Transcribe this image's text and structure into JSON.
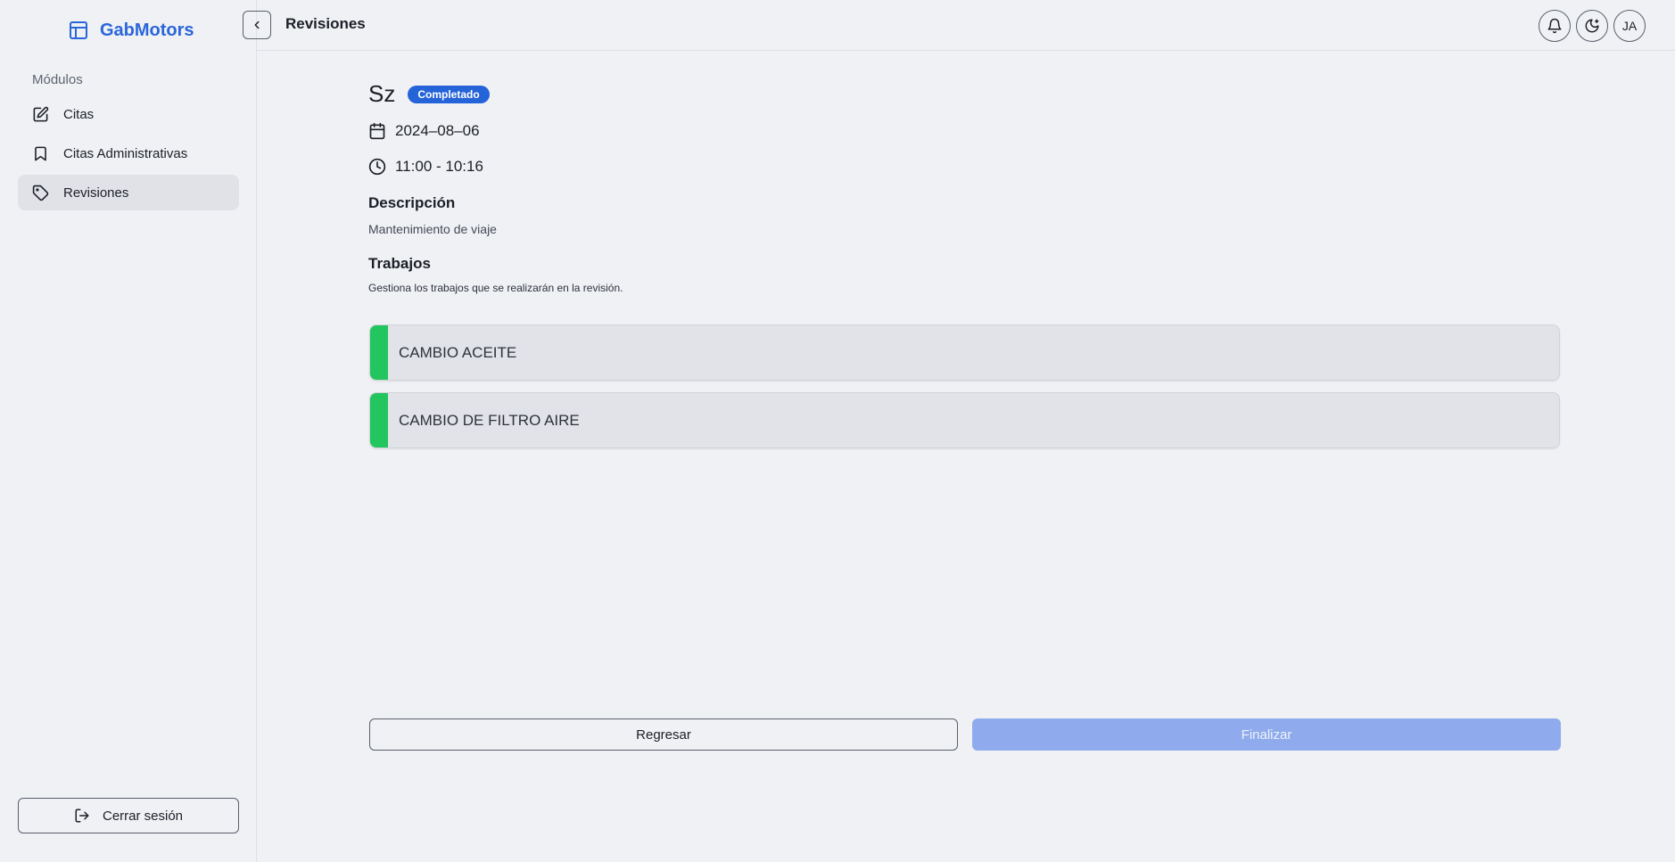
{
  "brand": {
    "name": "GabMotors"
  },
  "sidebar": {
    "section_label": "Módulos",
    "items": [
      {
        "label": "Citas",
        "icon": "edit-icon"
      },
      {
        "label": "Citas Administrativas",
        "icon": "bookmark-icon"
      },
      {
        "label": "Revisiones",
        "icon": "tag-icon",
        "active": true
      }
    ],
    "logout_label": "Cerrar sesión"
  },
  "header": {
    "title": "Revisiones",
    "avatar_initials": "JA"
  },
  "revision": {
    "vehicle": "Sz",
    "status": "Completado",
    "date": "2024–08–06",
    "time": "11:00 - 10:16",
    "description_heading": "Descripción",
    "description": "Mantenimiento de viaje",
    "jobs_heading": "Trabajos",
    "jobs_subtitle": "Gestiona los trabajos que se realizarán en la revisión.",
    "jobs": [
      {
        "label": "CAMBIO ACEITE",
        "status_color": "#22c55e"
      },
      {
        "label": "CAMBIO DE FILTRO AIRE",
        "status_color": "#22c55e"
      }
    ]
  },
  "actions": {
    "back_label": "Regresar",
    "finish_label": "Finalizar"
  },
  "colors": {
    "accent": "#2563d8",
    "finish_disabled": "#8fabed",
    "job_done": "#22c55e"
  }
}
